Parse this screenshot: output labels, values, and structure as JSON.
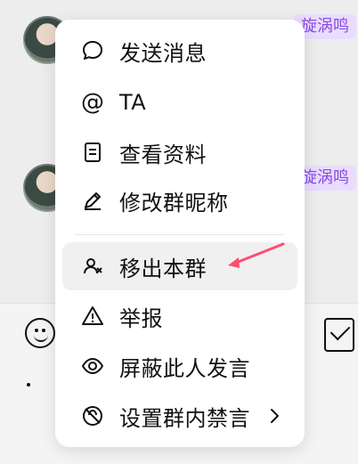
{
  "background": {
    "tags": [
      "旋涡鸣",
      "旋涡鸣"
    ]
  },
  "menu": {
    "items": [
      {
        "label": "发送消息",
        "icon": "chat-bubble-icon"
      },
      {
        "label": "TA",
        "icon": "at-icon",
        "prefix": "@"
      },
      {
        "label": "查看资料",
        "icon": "document-icon"
      },
      {
        "label": "修改群昵称",
        "icon": "pencil-icon"
      },
      {
        "label": "移出本群",
        "icon": "remove-user-icon"
      },
      {
        "label": "举报",
        "icon": "warning-icon"
      },
      {
        "label": "屏蔽此人发言",
        "icon": "eye-icon"
      },
      {
        "label": "设置群内禁言",
        "icon": "mute-icon"
      }
    ]
  },
  "colors": {
    "accent": "#ff4d6d",
    "tag_bg": "#e9dcff",
    "tag_text": "#8a4be6"
  }
}
